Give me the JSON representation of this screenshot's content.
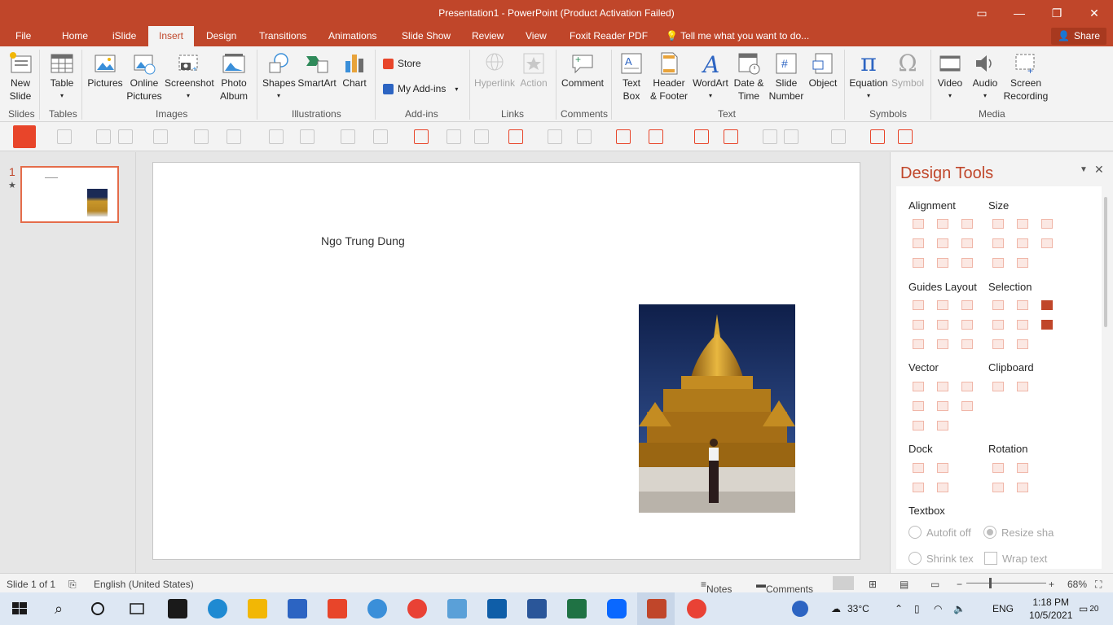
{
  "window": {
    "title": "Presentation1 - PowerPoint (Product Activation Failed)",
    "accent": "#c0462a"
  },
  "tabs": [
    {
      "label": "File"
    },
    {
      "label": "Home"
    },
    {
      "label": "iSlide"
    },
    {
      "label": "Insert",
      "active": true
    },
    {
      "label": "Design"
    },
    {
      "label": "Transitions"
    },
    {
      "label": "Animations"
    },
    {
      "label": "Slide Show"
    },
    {
      "label": "Review"
    },
    {
      "label": "View"
    },
    {
      "label": "Foxit Reader PDF"
    }
  ],
  "tell_me": "Tell me what you want to do...",
  "share": "Share",
  "ribbon": {
    "new_slide": "New\nSlide",
    "table": "Table",
    "pictures": "Pictures",
    "online_pictures": "Online\nPictures",
    "screenshot": "Screenshot",
    "photo_album": "Photo\nAlbum",
    "shapes": "Shapes",
    "smartart": "SmartArt",
    "chart": "Chart",
    "store": "Store",
    "my_addins": "My Add-ins",
    "hyperlink": "Hyperlink",
    "action": "Action",
    "comment": "Comment",
    "text_box": "Text\nBox",
    "header_footer": "Header\n& Footer",
    "wordart": "WordArt",
    "date_time": "Date &\nTime",
    "slide_number": "Slide\nNumber",
    "object": "Object",
    "equation": "Equation",
    "symbol": "Symbol",
    "video": "Video",
    "audio": "Audio",
    "screen_recording": "Screen\nRecording",
    "groups": {
      "slides": "Slides",
      "tables": "Tables",
      "images": "Images",
      "illustrations": "Illustrations",
      "addins": "Add-ins",
      "links": "Links",
      "comments": "Comments",
      "text": "Text",
      "symbols": "Symbols",
      "media": "Media"
    }
  },
  "slide_panel": {
    "number": "1",
    "star": "★"
  },
  "slide": {
    "text": "Ngo Trung Dung"
  },
  "design_tools": {
    "title": "Design Tools",
    "sections": {
      "alignment": "Alignment",
      "size": "Size",
      "guides_layout": "Guides Layout",
      "selection": "Selection",
      "vector": "Vector",
      "clipboard": "Clipboard",
      "dock": "Dock",
      "rotation": "Rotation",
      "textbox": "Textbox"
    },
    "options": {
      "autofit": "Autofit off",
      "resize": "Resize sha",
      "shrink": "Shrink tex",
      "wrap": "Wrap text"
    }
  },
  "status": {
    "slide_of": "Slide 1 of 1",
    "language": "English (United States)",
    "notes": "Notes",
    "comments": "Comments",
    "zoom": "68%"
  },
  "tray": {
    "temp": "33°C",
    "lang": "ENG",
    "time": "1:18 PM",
    "date": "10/5/2021",
    "notif": "20"
  }
}
